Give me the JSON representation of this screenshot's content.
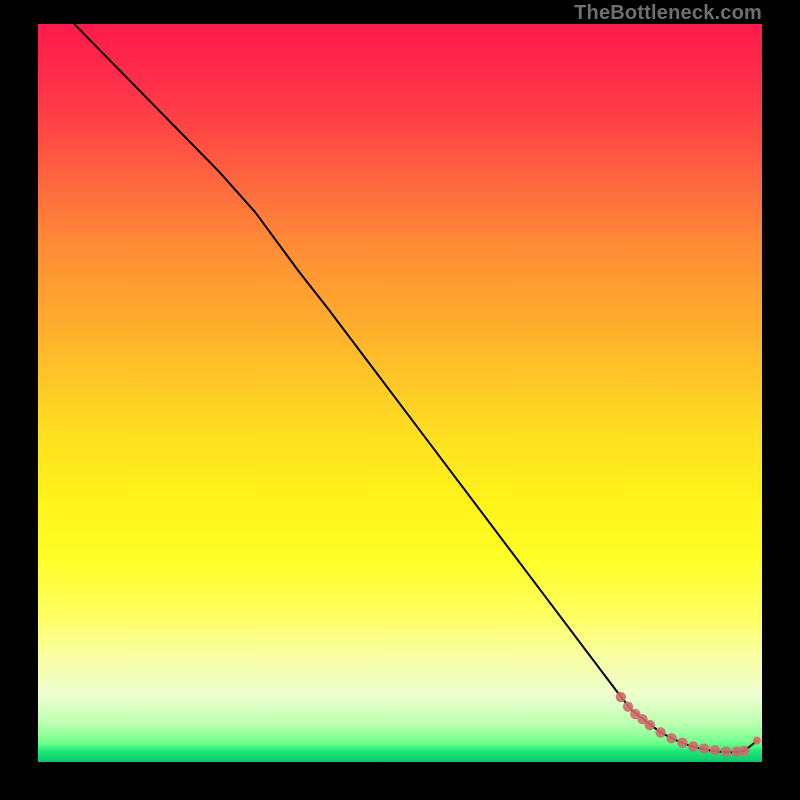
{
  "watermark": "TheBottleneck.com",
  "chart_data": {
    "type": "line",
    "title": "",
    "xlabel": "",
    "ylabel": "",
    "xlim": [
      0,
      100
    ],
    "ylim": [
      0,
      100
    ],
    "colors": {
      "line": "#000000",
      "markers": "#cf6a6a",
      "endpoint": "#e06a6a",
      "background_top": "#ff1a4a",
      "background_bottom": "#07c86a"
    },
    "series": [
      {
        "name": "curve",
        "kind": "line",
        "x": [
          5,
          10,
          15,
          20,
          25,
          30,
          33,
          36,
          40,
          45,
          50,
          55,
          60,
          65,
          70,
          75,
          80,
          82,
          84,
          86,
          88,
          90,
          92,
          94,
          96,
          97.5,
          99.5
        ],
        "y": [
          100,
          95.0,
          90.0,
          85.0,
          80.0,
          74.5,
          70.5,
          66.5,
          61.5,
          55.0,
          48.5,
          42.0,
          35.5,
          29.0,
          22.5,
          16.0,
          9.5,
          7.0,
          5.5,
          4.0,
          3.0,
          2.2,
          1.7,
          1.4,
          1.3,
          1.5,
          3.0
        ]
      },
      {
        "name": "low-region-markers",
        "kind": "scatter",
        "x": [
          80.5,
          81.5,
          82.5,
          83.5,
          84.5,
          86.0,
          87.5,
          89.0,
          90.5,
          92.0,
          93.5,
          95.0,
          96.5,
          97.5
        ],
        "y": [
          8.8,
          7.5,
          6.5,
          5.8,
          5.0,
          4.0,
          3.2,
          2.6,
          2.1,
          1.8,
          1.6,
          1.4,
          1.4,
          1.5
        ]
      },
      {
        "name": "endpoint",
        "kind": "scatter",
        "x": [
          99.3
        ],
        "y": [
          2.9
        ]
      }
    ]
  }
}
